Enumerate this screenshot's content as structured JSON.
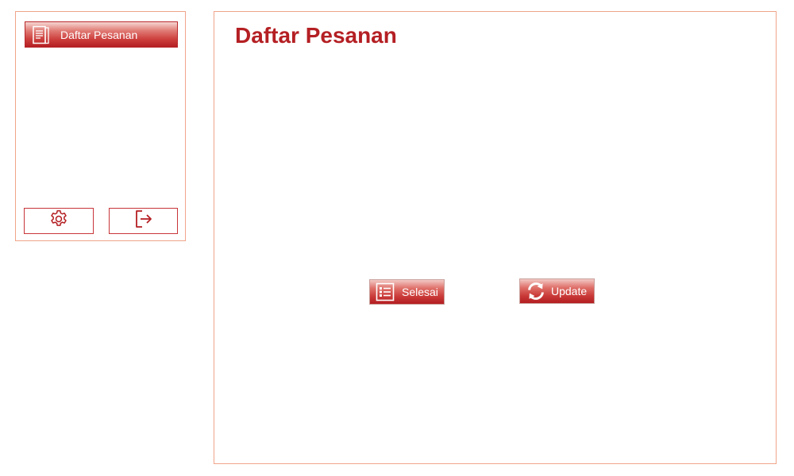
{
  "sidebar": {
    "nav_items": [
      {
        "label": "Daftar Pesanan",
        "icon": "book-icon"
      }
    ],
    "settings_icon": "gear-icon",
    "logout_icon": "logout-icon"
  },
  "main": {
    "title": "Daftar Pesanan",
    "actions": {
      "selesai_label": "Selesai",
      "selesai_icon": "list-icon",
      "update_label": "Update",
      "update_icon": "refresh-icon"
    }
  },
  "colors": {
    "accent": "#b41f23",
    "border": "#f0a58a"
  }
}
